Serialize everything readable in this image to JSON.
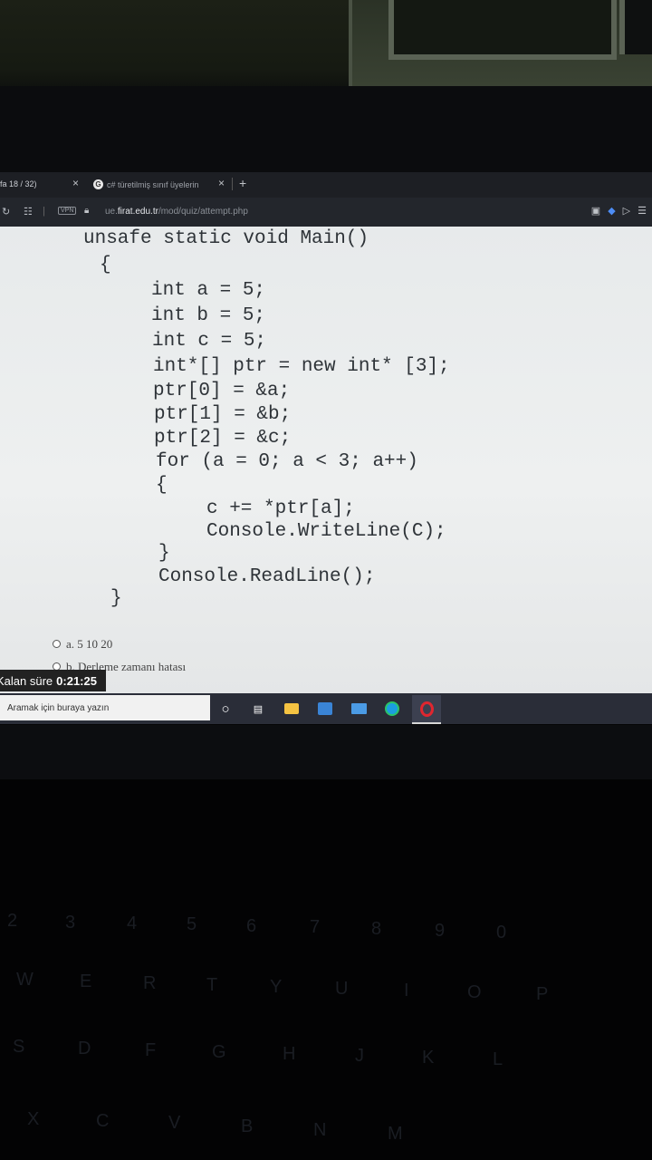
{
  "browser": {
    "tab1_label": "fa 18 / 32)",
    "tab1_close": "×",
    "tab2_icon": "G",
    "tab2_label": "c# türetilmiş sınıf üyelerin",
    "tab2_close": "×",
    "new_tab": "+",
    "vpn_badge": "VPN",
    "url_prefix": "ue.",
    "url_host": "firat.edu.tr",
    "url_path": "/mod/quiz/attempt.php"
  },
  "code_lines": [
    "unsafe static void Main()",
    "{",
    "int a = 5;",
    "int b = 5;",
    "int c = 5;",
    "int*[] ptr = new int* [3];",
    "ptr[0] = &a;",
    "ptr[1] = &b;",
    "ptr[2] = &c;",
    "for (a = 0; a < 3; a++)",
    "{",
    "c += *ptr[a];",
    "Console.WriteLine(C);",
    "}",
    "Console.ReadLine();",
    "}"
  ],
  "answers": [
    {
      "label": "a. 5 10 20"
    },
    {
      "label": "b. Derleme zamanı hatası"
    }
  ],
  "timer": {
    "label": "Kalan süre",
    "value": "0:21:25"
  },
  "taskbar": {
    "search_placeholder": "Aramak için buraya yazın"
  },
  "keyboard_keys": [
    "2",
    "3",
    "4",
    "5",
    "6",
    "7",
    "8",
    "9",
    "0",
    "W",
    "E",
    "R",
    "T",
    "Y",
    "U",
    "I",
    "O",
    "P",
    "S",
    "D",
    "F",
    "G",
    "H",
    "J",
    "K",
    "L",
    "X",
    "C",
    "V",
    "B",
    "N",
    "M"
  ]
}
